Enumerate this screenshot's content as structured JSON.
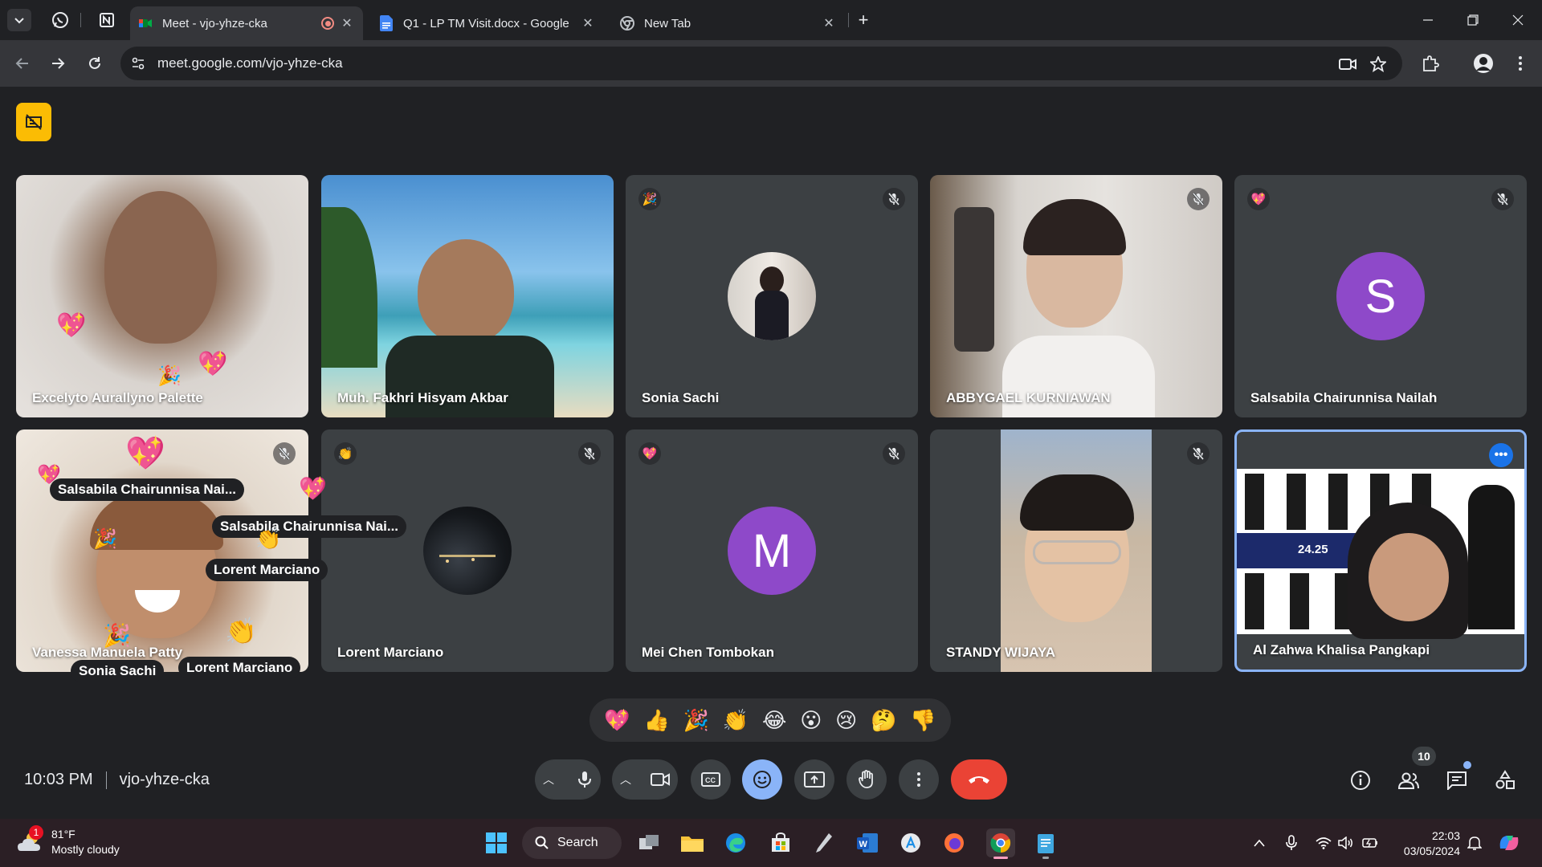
{
  "browser": {
    "tabs": [
      {
        "title": "Meet - vjo-yhze-cka",
        "active": true,
        "recording": true
      },
      {
        "title": "Q1 - LP TM Visit.docx - Google",
        "active": false
      },
      {
        "title": "New Tab",
        "active": false
      }
    ],
    "url": "meet.google.com/vjo-yhze-cka"
  },
  "meet": {
    "tiles": [
      {
        "name": "Excelyto Aurallyno Palette"
      },
      {
        "name": "Muh. Fakhri Hisyam Akbar"
      },
      {
        "name": "Sonia Sachi",
        "reaction": "🎉"
      },
      {
        "name": "ABBYGAEL KURNIAWAN"
      },
      {
        "name": "Salsabila Chairunnisa Nailah",
        "avatar_letter": "S",
        "reaction": "💖"
      },
      {
        "name": "Vanessa Manuela Patty"
      },
      {
        "name": "Lorent Marciano",
        "reaction": "👏"
      },
      {
        "name": "Mei Chen Tombokan",
        "avatar_letter": "M",
        "reaction": "💖"
      },
      {
        "name": "STANDY WIJAYA"
      },
      {
        "name": "Al Zahwa Khalisa Pangkapi",
        "screen_text": "24.25"
      }
    ],
    "floating_names": [
      "Salsabila Chairunnisa Nai...",
      "Salsabila Chairunnisa Nai...",
      "Lorent Marciano",
      "Sonia Sachi",
      "Lorent Marciano"
    ],
    "reactions": [
      "💖",
      "👍",
      "🎉",
      "👏",
      "😂",
      "😮",
      "😢",
      "🤔",
      "👎"
    ],
    "time": "10:03 PM",
    "meeting_code": "vjo-yhze-cka",
    "participant_count": "10",
    "colors": {
      "accent": "#8ab4f8",
      "end_call": "#ea4335",
      "avatar": "#8e49c9",
      "recording": "#fbbc04"
    }
  },
  "taskbar": {
    "weather": {
      "temp": "81°F",
      "desc": "Mostly cloudy",
      "badge": "1"
    },
    "search": "Search",
    "clock_time": "22:03",
    "clock_date": "03/05/2024"
  }
}
